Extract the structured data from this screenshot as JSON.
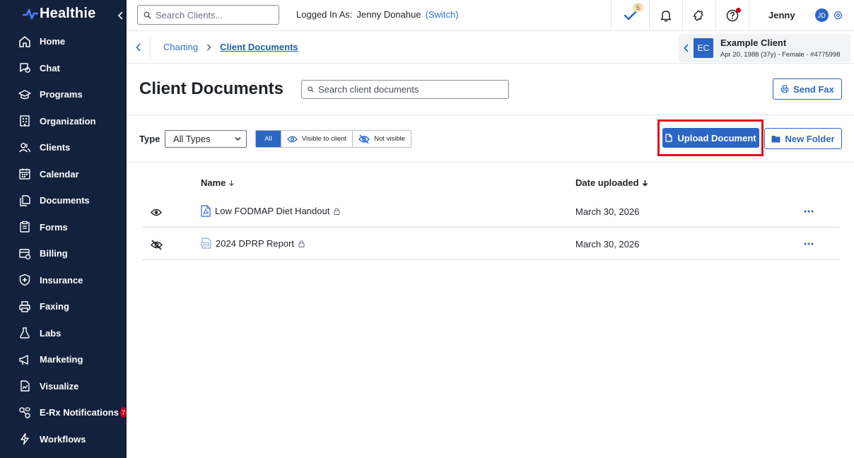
{
  "app": {
    "logo_text": "Healthie"
  },
  "sidebar": {
    "items": [
      {
        "label": "Home",
        "icon": "home-icon"
      },
      {
        "label": "Chat",
        "icon": "chat-icon"
      },
      {
        "label": "Programs",
        "icon": "programs-icon"
      },
      {
        "label": "Organization",
        "icon": "organization-icon"
      },
      {
        "label": "Clients",
        "icon": "clients-icon"
      },
      {
        "label": "Calendar",
        "icon": "calendar-icon"
      },
      {
        "label": "Documents",
        "icon": "documents-icon"
      },
      {
        "label": "Forms",
        "icon": "forms-icon"
      },
      {
        "label": "Billing",
        "icon": "billing-icon"
      },
      {
        "label": "Insurance",
        "icon": "insurance-icon"
      },
      {
        "label": "Faxing",
        "icon": "faxing-icon"
      },
      {
        "label": "Labs",
        "icon": "labs-icon"
      },
      {
        "label": "Marketing",
        "icon": "marketing-icon"
      },
      {
        "label": "Visualize",
        "icon": "visualize-icon"
      },
      {
        "label": "E-Rx Notifications",
        "icon": "erx-icon",
        "badge": "7"
      },
      {
        "label": "Workflows",
        "icon": "workflows-icon"
      }
    ]
  },
  "topbar": {
    "search_placeholder": "Search Clients...",
    "logged_in_label": "Logged In As:",
    "logged_in_name": "Jenny Donahue",
    "switch_label": "(Switch)",
    "tasks_count": "5",
    "user_name": "Jenny",
    "user_initials": "JD"
  },
  "breadcrumb": {
    "items": [
      "Charting",
      "Client Documents"
    ]
  },
  "client": {
    "initials": "EC",
    "name": "Example Client",
    "meta": "Apr 20, 1988 (37y) - Female - #4775998"
  },
  "page": {
    "title": "Client Documents",
    "search_placeholder": "Search client documents",
    "send_fax_label": "Send Fax"
  },
  "filters": {
    "type_label": "Type",
    "type_selected": "All Types",
    "segments": [
      "All",
      "Visible to client",
      "Not visible"
    ],
    "upload_label": "Upload Document",
    "new_folder_label": "New Folder"
  },
  "table": {
    "columns": [
      "Name",
      "Date uploaded"
    ],
    "rows": [
      {
        "name": "Low FODMAP Diet Handout",
        "date": "March 30, 2026",
        "visibility": "visible",
        "file_icon": "pdf-file-icon"
      },
      {
        "name": "2024 DPRP Report",
        "date": "March 30, 2026",
        "visibility": "not-visible",
        "file_icon": "doc-file-icon"
      }
    ]
  },
  "colors": {
    "sidebar_bg": "#14213d",
    "accent": "#2b66c5",
    "highlight_frame": "#e0101a",
    "badge_red": "#d0021b"
  }
}
